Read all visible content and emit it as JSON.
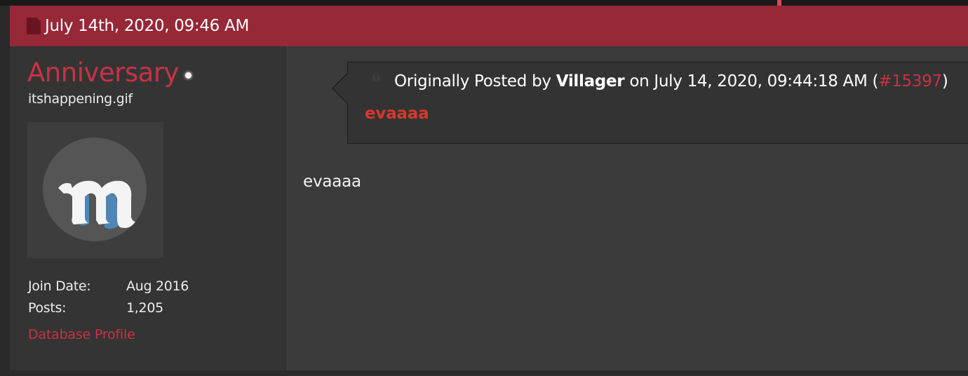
{
  "post": {
    "date": "July 14th, 2020, 09:46 AM",
    "message": "evaaaa"
  },
  "user": {
    "name": "Anniversary",
    "title": "itshappening.gif",
    "avatar_icon": "m-logo-avatar",
    "stats": [
      {
        "label": "Join Date:",
        "value": "Aug 2016"
      },
      {
        "label": "Posts:",
        "value": "1,205"
      }
    ],
    "profile_link": "Database Profile"
  },
  "quote": {
    "prefix": "Originally Posted by",
    "author": "Villager",
    "on": "on",
    "timestamp": "July 14, 2020, 09:44:18 AM",
    "open_paren": "(",
    "post_link": "#15397",
    "close_paren": ")",
    "message": "evaaaa"
  },
  "colors": {
    "header_bg": "#962837",
    "accent": "#c93146",
    "quote_text": "#d6382c"
  }
}
